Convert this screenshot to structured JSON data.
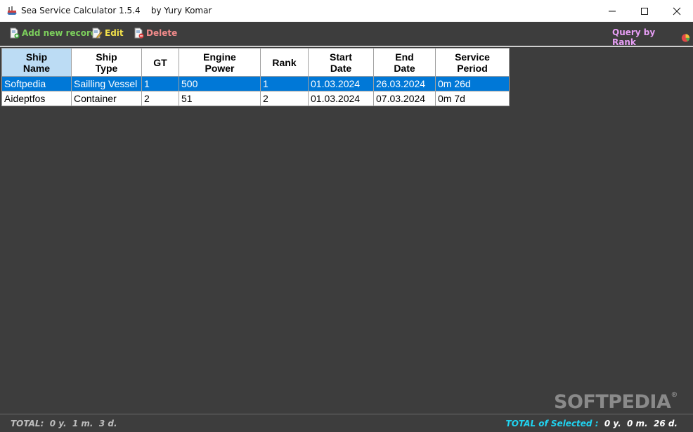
{
  "window": {
    "title": "Sea Service Calculator 1.5.4    by Yury Komar",
    "minimize_glyph": "—",
    "maximize_glyph": "☐",
    "close_glyph": "✕"
  },
  "toolbar": {
    "add_label": "Add new record",
    "edit_label": "Edit",
    "delete_label": "Delete",
    "query_label": "Query by Rank",
    "colors": {
      "add": "#7ccf5c",
      "edit": "#f2e14a",
      "delete": "#f08a8a",
      "query": "#e79ef5"
    }
  },
  "grid": {
    "headers": [
      {
        "line1": "Ship",
        "line2": "Name"
      },
      {
        "line1": "Ship",
        "line2": "Type"
      },
      {
        "line1": "GT",
        "line2": ""
      },
      {
        "line1": "Engine",
        "line2": "Power"
      },
      {
        "line1": "Rank",
        "line2": ""
      },
      {
        "line1": "Start",
        "line2": "Date"
      },
      {
        "line1": "End",
        "line2": "Date"
      },
      {
        "line1": "Service",
        "line2": "Period"
      }
    ],
    "rows": [
      [
        "Softpedia",
        "Sailling Vessel",
        "1",
        "500",
        "1",
        "01.03.2024",
        "26.03.2024",
        "0m 26d"
      ],
      [
        "Aideptfos",
        "Container",
        "2",
        "51",
        "2",
        "01.03.2024",
        "07.03.2024",
        "0m 7d"
      ]
    ],
    "selected_row": 0
  },
  "status": {
    "total_label": "TOTAL:",
    "total_value": "0 y.  1 m.  3 d.",
    "selected_label": "TOTAL of Selected :",
    "selected_value": "0 y.  0 m.  26 d.",
    "colors": {
      "selected_label": "#20d3f0",
      "selected_value": "#ffffff"
    }
  },
  "watermark": {
    "text": "SOFTPEDIA",
    "mark": "®"
  }
}
